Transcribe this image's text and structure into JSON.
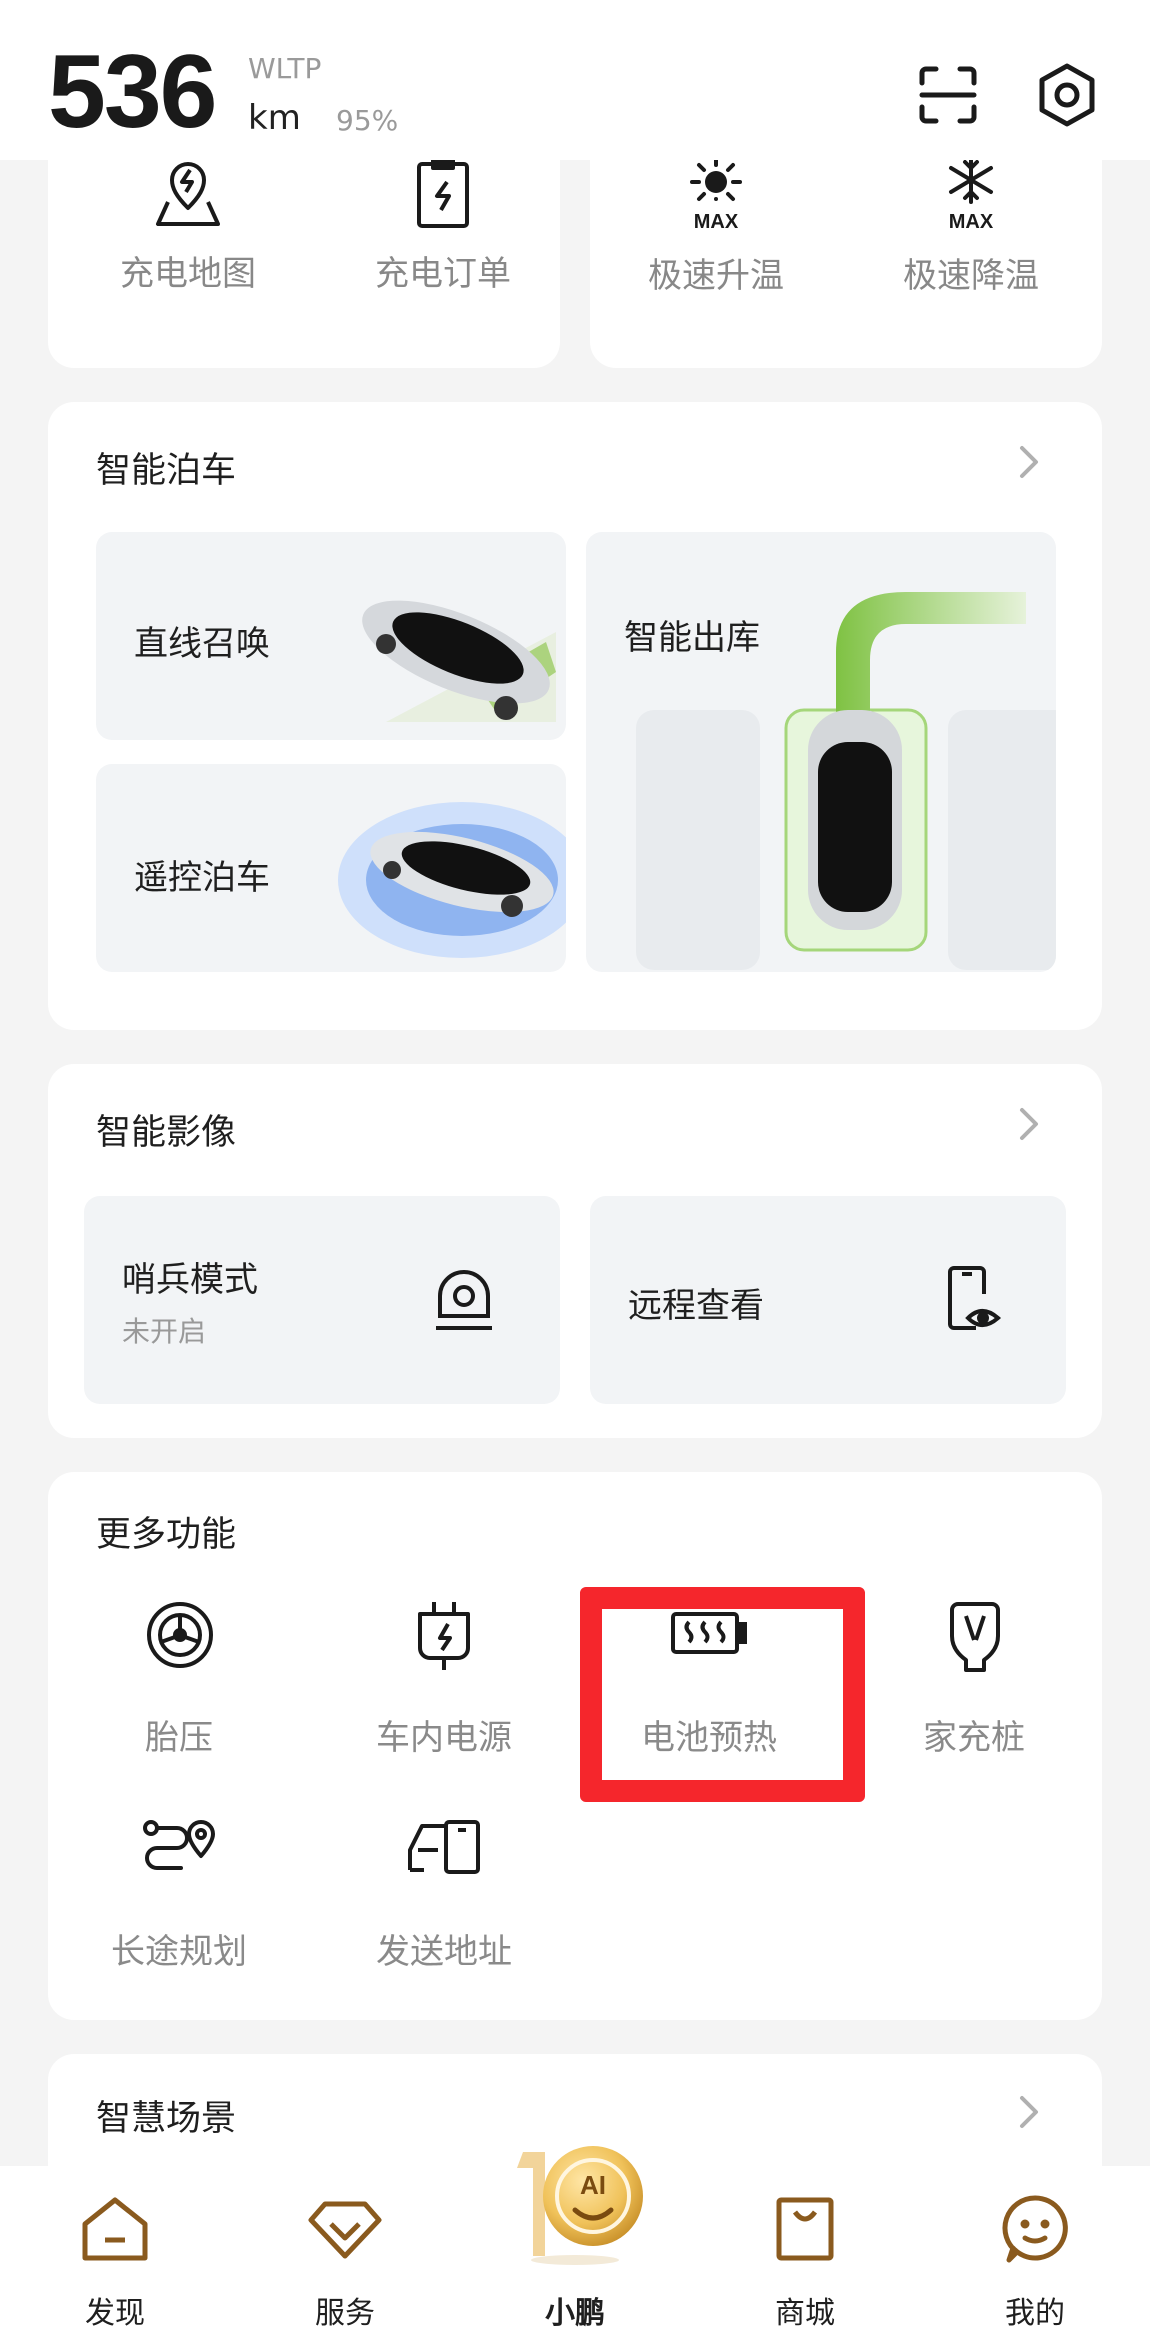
{
  "header": {
    "range_value": "536",
    "range_standard": "WLTP",
    "range_unit": "km",
    "battery_percent": "95%"
  },
  "quick_actions": [
    {
      "label": "充电地图",
      "icon": "charge-map-icon"
    },
    {
      "label": "充电订单",
      "icon": "charge-order-icon"
    },
    {
      "label": "极速升温",
      "icon": "max-heat-icon",
      "icon_text": "MAX"
    },
    {
      "label": "极速降温",
      "icon": "max-cool-icon",
      "icon_text": "MAX"
    }
  ],
  "smart_parking": {
    "title": "智能泊车",
    "tiles": [
      {
        "label": "直线召唤"
      },
      {
        "label": "智能出库"
      },
      {
        "label": "遥控泊车"
      }
    ]
  },
  "smart_camera": {
    "title": "智能影像",
    "tiles": [
      {
        "label": "哨兵模式",
        "sub": "未开启",
        "icon": "sentry-camera-icon"
      },
      {
        "label": "远程查看",
        "icon": "remote-view-icon"
      }
    ]
  },
  "more_functions": {
    "title": "更多功能",
    "items": [
      {
        "label": "胎压",
        "icon": "tire-pressure-icon"
      },
      {
        "label": "车内电源",
        "icon": "car-power-plug-icon"
      },
      {
        "label": "电池预热",
        "icon": "battery-preheat-icon"
      },
      {
        "label": "家充桩",
        "icon": "home-charger-icon"
      },
      {
        "label": "长途规划",
        "icon": "route-planning-icon"
      },
      {
        "label": "发送地址",
        "icon": "send-address-icon"
      }
    ]
  },
  "smart_scene": {
    "title": "智慧场景"
  },
  "bottom_nav": [
    {
      "label": "发现",
      "icon": "discover-home-icon"
    },
    {
      "label": "服务",
      "icon": "service-gem-icon"
    },
    {
      "label": "小鹏",
      "icon": "xpeng-ai-icon",
      "active": true,
      "badge_text": "AI"
    },
    {
      "label": "商城",
      "icon": "mall-bag-icon"
    },
    {
      "label": "我的",
      "icon": "profile-face-icon"
    }
  ],
  "colors": {
    "accent_brown": "#8a5a1e",
    "gold": "#e6b64d",
    "green": "#8bc34a",
    "highlight_red": "#f5262c"
  }
}
